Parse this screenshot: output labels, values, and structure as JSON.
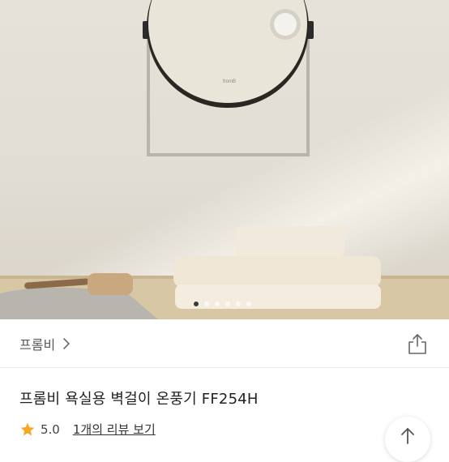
{
  "product": {
    "brand": "프롬비",
    "title": "프롬비 욕실용 벽걸이 온풍기 FF254H",
    "heater_logo_text": "fromB",
    "rating": "5.0",
    "review_link": "1개의 리뷰 보기"
  },
  "gallery": {
    "image_count": 6,
    "active_index": 0
  },
  "icons": {
    "brand_arrow": "chevron-right-icon",
    "share": "share-icon",
    "star": "star-icon",
    "scroll_top": "arrow-up-icon"
  },
  "colors": {
    "star": "#f6a823",
    "active_dot": "#3a3a3a"
  }
}
